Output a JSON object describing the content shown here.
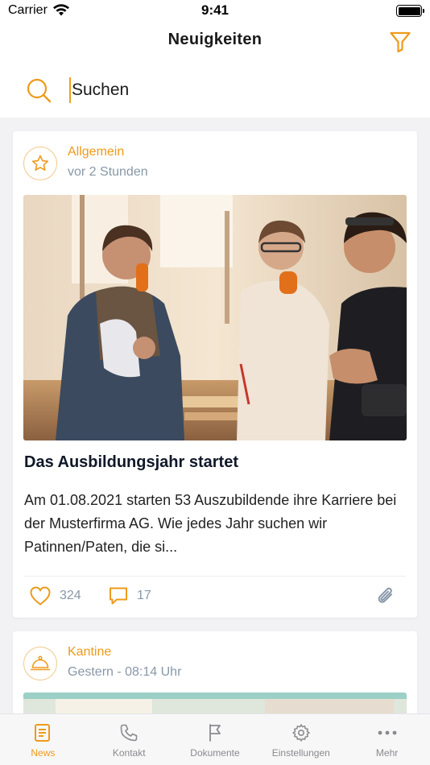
{
  "status": {
    "carrier": "Carrier",
    "time": "9:41"
  },
  "header": {
    "title": "Neuigkeiten"
  },
  "search": {
    "placeholder": "Suchen"
  },
  "posts": [
    {
      "category": "Allgemein",
      "category_icon": "star-icon",
      "time": "vor 2 Stunden",
      "title": "Das Ausbildungsjahr startet",
      "body": "Am 01.08.2021 starten 53 Auszubildende ihre Karriere bei der Musterfirma AG. Wie jedes Jahr suchen wir Patinnen/Paten, die si...",
      "likes": "324",
      "comments": "17",
      "has_attachment": true
    },
    {
      "category": "Kantine",
      "category_icon": "cloche-icon",
      "time": "Gestern - 08:14 Uhr"
    }
  ],
  "tabs": [
    {
      "label": "News",
      "icon": "news-icon",
      "active": true
    },
    {
      "label": "Kontakt",
      "icon": "phone-icon",
      "active": false
    },
    {
      "label": "Dokumente",
      "icon": "flag-icon",
      "active": false
    },
    {
      "label": "Einstellungen",
      "icon": "gear-icon",
      "active": false
    },
    {
      "label": "Mehr",
      "icon": "more-icon",
      "active": false
    }
  ],
  "colors": {
    "accent": "#ee9a1a",
    "muted": "#8898a8",
    "background": "#f2f2f4"
  }
}
